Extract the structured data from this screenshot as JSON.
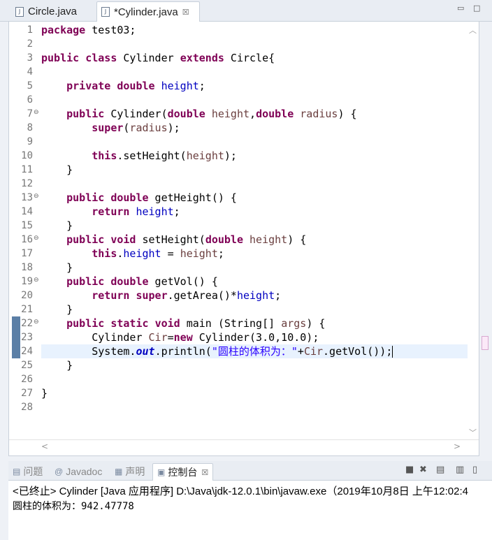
{
  "editor_tabs": [
    {
      "label": "Circle.java",
      "icon": "java-file-icon"
    },
    {
      "label": "*Cylinder.java",
      "icon": "java-file-icon",
      "close": "☒"
    }
  ],
  "window_controls": {
    "minimize": "▭",
    "maximize": "□"
  },
  "code_lines": [
    [
      {
        "t": "package",
        "c": "kw"
      },
      {
        "t": " test03;"
      }
    ],
    [],
    [
      {
        "t": "public",
        "c": "kw"
      },
      {
        "t": " "
      },
      {
        "t": "class",
        "c": "kw"
      },
      {
        "t": " Cylinder "
      },
      {
        "t": "extends",
        "c": "kw"
      },
      {
        "t": " Circle{"
      }
    ],
    [],
    [
      {
        "t": "    "
      },
      {
        "t": "private",
        "c": "kw"
      },
      {
        "t": " "
      },
      {
        "t": "double",
        "c": "kw"
      },
      {
        "t": " "
      },
      {
        "t": "height",
        "c": "fld"
      },
      {
        "t": ";"
      }
    ],
    [],
    [
      {
        "t": "    "
      },
      {
        "t": "public",
        "c": "kw"
      },
      {
        "t": " Cylinder("
      },
      {
        "t": "double",
        "c": "kw"
      },
      {
        "t": " "
      },
      {
        "t": "height",
        "c": "par"
      },
      {
        "t": ","
      },
      {
        "t": "double",
        "c": "kw"
      },
      {
        "t": " "
      },
      {
        "t": "radius",
        "c": "par"
      },
      {
        "t": ") {"
      }
    ],
    [
      {
        "t": "        "
      },
      {
        "t": "super",
        "c": "kw"
      },
      {
        "t": "("
      },
      {
        "t": "radius",
        "c": "par"
      },
      {
        "t": ");"
      }
    ],
    [],
    [
      {
        "t": "        "
      },
      {
        "t": "this",
        "c": "kw"
      },
      {
        "t": ".setHeight("
      },
      {
        "t": "height",
        "c": "par"
      },
      {
        "t": ");"
      }
    ],
    [
      {
        "t": "    }"
      }
    ],
    [],
    [
      {
        "t": "    "
      },
      {
        "t": "public",
        "c": "kw"
      },
      {
        "t": " "
      },
      {
        "t": "double",
        "c": "kw"
      },
      {
        "t": " getHeight() {"
      }
    ],
    [
      {
        "t": "        "
      },
      {
        "t": "return",
        "c": "kw"
      },
      {
        "t": " "
      },
      {
        "t": "height",
        "c": "fld"
      },
      {
        "t": ";"
      }
    ],
    [
      {
        "t": "    }"
      }
    ],
    [
      {
        "t": "    "
      },
      {
        "t": "public",
        "c": "kw"
      },
      {
        "t": " "
      },
      {
        "t": "void",
        "c": "kw"
      },
      {
        "t": " setHeight("
      },
      {
        "t": "double",
        "c": "kw"
      },
      {
        "t": " "
      },
      {
        "t": "height",
        "c": "par"
      },
      {
        "t": ") {"
      }
    ],
    [
      {
        "t": "        "
      },
      {
        "t": "this",
        "c": "kw"
      },
      {
        "t": "."
      },
      {
        "t": "height",
        "c": "fld"
      },
      {
        "t": " = "
      },
      {
        "t": "height",
        "c": "par"
      },
      {
        "t": ";"
      }
    ],
    [
      {
        "t": "    }"
      }
    ],
    [
      {
        "t": "    "
      },
      {
        "t": "public",
        "c": "kw"
      },
      {
        "t": " "
      },
      {
        "t": "double",
        "c": "kw"
      },
      {
        "t": " getVol() {"
      }
    ],
    [
      {
        "t": "        "
      },
      {
        "t": "return",
        "c": "kw"
      },
      {
        "t": " "
      },
      {
        "t": "super",
        "c": "kw"
      },
      {
        "t": ".getArea()*"
      },
      {
        "t": "height",
        "c": "fld"
      },
      {
        "t": ";"
      }
    ],
    [
      {
        "t": "    }"
      }
    ],
    [
      {
        "t": "    "
      },
      {
        "t": "public",
        "c": "kw"
      },
      {
        "t": " "
      },
      {
        "t": "static",
        "c": "kw"
      },
      {
        "t": " "
      },
      {
        "t": "void",
        "c": "kw"
      },
      {
        "t": " main (String[] "
      },
      {
        "t": "args",
        "c": "par"
      },
      {
        "t": ") {"
      }
    ],
    [
      {
        "t": "        Cylinder "
      },
      {
        "t": "Cir",
        "c": "par"
      },
      {
        "t": "="
      },
      {
        "t": "new",
        "c": "kw"
      },
      {
        "t": " Cylinder(3.0,10.0);"
      }
    ],
    [
      {
        "t": "        System."
      },
      {
        "t": "out",
        "c": "st"
      },
      {
        "t": ".println("
      },
      {
        "t": "\"圆柱的体积为：\"",
        "c": "str"
      },
      {
        "t": "+"
      },
      {
        "t": "Cir",
        "c": "par"
      },
      {
        "t": ".getVol());"
      }
    ],
    [
      {
        "t": "    }"
      }
    ],
    [],
    [
      {
        "t": "}"
      }
    ],
    []
  ],
  "line_numbers": [
    "1",
    "2",
    "3",
    "4",
    "5",
    "6",
    "7",
    "8",
    "9",
    "10",
    "11",
    "12",
    "13",
    "14",
    "15",
    "16",
    "17",
    "18",
    "19",
    "20",
    "21",
    "22",
    "23",
    "24",
    "25",
    "26",
    "27",
    "28"
  ],
  "fold_lines": [
    7,
    13,
    16,
    19,
    22
  ],
  "marked_lines": [
    22,
    23,
    24
  ],
  "current_line": 24,
  "console_tabs": [
    {
      "label": "问题",
      "icon": "problems-icon",
      "glyph": "▤"
    },
    {
      "label": "Javadoc",
      "icon": "javadoc-icon",
      "glyph": "@"
    },
    {
      "label": "声明",
      "icon": "declaration-icon",
      "glyph": "▦"
    },
    {
      "label": "控制台",
      "icon": "console-icon",
      "glyph": "▣",
      "close": "☒"
    }
  ],
  "console_toolbar": [
    "■",
    "✖",
    "▤",
    "▥",
    "▯"
  ],
  "console": {
    "status": "<已终止> Cylinder [Java 应用程序] D:\\Java\\jdk-12.0.1\\bin\\javaw.exe（2019年10月8日 上午12:02:4",
    "output": "圆柱的体积为：942.47778"
  }
}
